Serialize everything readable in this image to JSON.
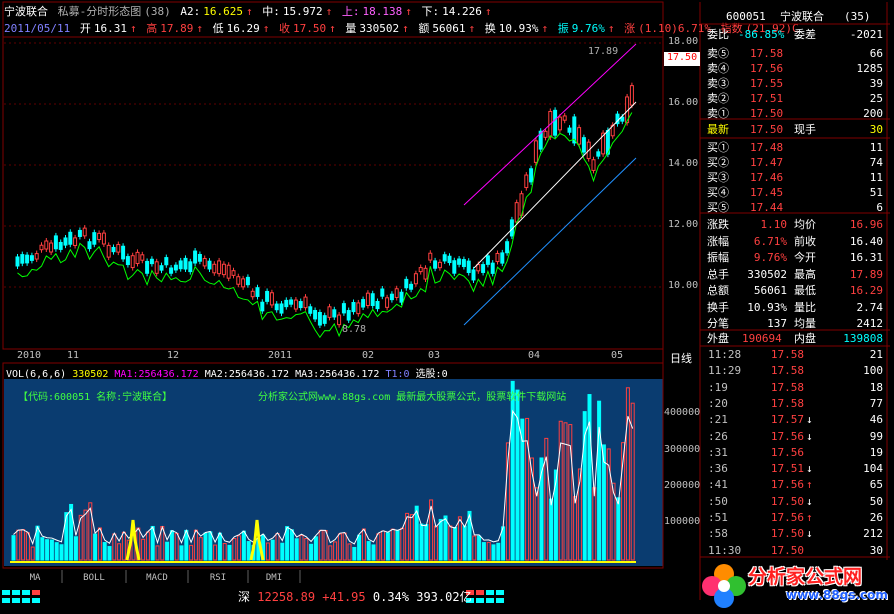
{
  "header": {
    "stock_name": "宁波联合",
    "formula": "私募-分时形态图",
    "params": "(38)",
    "a2_label": "A2:",
    "a2_value": "16.625",
    "mid_label": "中:",
    "mid_value": "15.972",
    "up_label": "上:",
    "up_value": "18.138",
    "down_label": "下:",
    "down_value": "14.226",
    "date": "2011/05/11",
    "open_label": "开",
    "open_value": "16.31",
    "high_label": "高",
    "high_value": "17.89",
    "low_label": "低",
    "low_value": "16.29",
    "close_label": "收",
    "close_value": "17.50",
    "vol_label": "量",
    "vol_value": "330502",
    "amt_label": "额",
    "amt_value": "56061",
    "turn_label": "换",
    "turn_value": "10.93%",
    "amp_label": "振",
    "amp_value": "9.76%",
    "chg_label": "涨",
    "chg_value": "(1.10)6.71%",
    "index_label": "指数",
    "index_value": "(21.92)C"
  },
  "price_axis": [
    "18.00",
    "16.00",
    "14.00",
    "12.00",
    "10.00"
  ],
  "price_tag": "17.50",
  "high_mark": "17.89",
  "low_mark": "8.78",
  "x_axis": [
    "2010",
    "11",
    "12",
    "2011",
    "02",
    "03",
    "04",
    "05"
  ],
  "day_line_label": "日线",
  "volume_header": {
    "vol_label": "VOL(6,6,6)",
    "vol_value": "330502",
    "ma1_label": "MA1:",
    "ma1_value": "256436.172",
    "ma2_label": "MA2:",
    "ma2_value": "256436.172",
    "ma3_label": "MA3:",
    "ma3_value": "256436.172",
    "t1_label": "T1:",
    "t1_value": "0",
    "pick_label": "选股:",
    "pick_value": "0"
  },
  "volume_overlay": {
    "code_text": "【代码:600051 名称:宁波联合】",
    "ad_text": "分析家公式网www.88gs.com 最新最大股票公式，股票软件下载网站"
  },
  "volume_axis": [
    "400000",
    "300000",
    "200000",
    "100000"
  ],
  "tabs": [
    "MA",
    "BOLL",
    "MACD",
    "RSI",
    "DMI"
  ],
  "quote": {
    "code": "600051",
    "name": "宁波联合",
    "badge": "(35)",
    "ratio_label": "委比",
    "ratio_value": "-86.85%",
    "diff_label": "委差",
    "diff_value": "-2021",
    "asks": [
      {
        "label": "卖⑤",
        "price": "17.58",
        "vol": "66"
      },
      {
        "label": "卖④",
        "price": "17.56",
        "vol": "1285"
      },
      {
        "label": "卖③",
        "price": "17.55",
        "vol": "39"
      },
      {
        "label": "卖②",
        "price": "17.51",
        "vol": "25"
      },
      {
        "label": "卖①",
        "price": "17.50",
        "vol": "200"
      }
    ],
    "last_label": "最新",
    "last_value": "17.50",
    "hand_label": "现手",
    "hand_value": "30",
    "bids": [
      {
        "label": "买①",
        "price": "17.48",
        "vol": "11"
      },
      {
        "label": "买②",
        "price": "17.47",
        "vol": "74"
      },
      {
        "label": "买③",
        "price": "17.46",
        "vol": "11"
      },
      {
        "label": "买④",
        "price": "17.45",
        "vol": "51"
      },
      {
        "label": "买⑤",
        "price": "17.44",
        "vol": "6"
      }
    ],
    "stats": [
      {
        "l1": "涨跌",
        "v1": "1.10",
        "l2": "均价",
        "v2": "16.96"
      },
      {
        "l1": "涨幅",
        "v1": "6.71%",
        "l2": "前收",
        "v2": "16.40"
      },
      {
        "l1": "振幅",
        "v1": "9.76%",
        "l2": "今开",
        "v2": "16.31"
      },
      {
        "l1": "总手",
        "v1": "330502",
        "l2": "最高",
        "v2": "17.89"
      },
      {
        "l1": "总额",
        "v1": "56061",
        "l2": "最低",
        "v2": "16.29"
      },
      {
        "l1": "换手",
        "v1": "10.93%",
        "l2": "量比",
        "v2": "2.74"
      },
      {
        "l1": "分笔",
        "v1": "137",
        "l2": "均量",
        "v2": "2412"
      }
    ],
    "outer_label": "外盘",
    "outer_value": "190694",
    "inner_label": "内盘",
    "inner_value": "139808"
  },
  "ticks": [
    {
      "time": "11:28",
      "price": "17.58",
      "arrow": "",
      "vol": "21"
    },
    {
      "time": "11:29",
      "price": "17.58",
      "arrow": "",
      "vol": "100"
    },
    {
      "time": ":19",
      "price": "17.58",
      "arrow": "",
      "vol": "18"
    },
    {
      "time": ":20",
      "price": "17.58",
      "arrow": "",
      "vol": "77"
    },
    {
      "time": ":21",
      "price": "17.57",
      "arrow": "↓",
      "vol": "46"
    },
    {
      "time": ":26",
      "price": "17.56",
      "arrow": "↓",
      "vol": "99"
    },
    {
      "time": ":31",
      "price": "17.56",
      "arrow": "",
      "vol": "19"
    },
    {
      "time": ":36",
      "price": "17.51",
      "arrow": "↓",
      "vol": "104"
    },
    {
      "time": ":41",
      "price": "17.56",
      "arrow": "↑",
      "vol": "65"
    },
    {
      "time": ":50",
      "price": "17.50",
      "arrow": "↓",
      "vol": "50"
    },
    {
      "time": ":51",
      "price": "17.56",
      "arrow": "↑",
      "vol": "26"
    },
    {
      "time": ":58",
      "price": "17.50",
      "arrow": "↓",
      "vol": "212"
    },
    {
      "time": "11:30",
      "price": "17.50",
      "arrow": "",
      "vol": "30"
    }
  ],
  "bottom": {
    "market": "深",
    "index_value": "12258.89",
    "index_change": "+41.95",
    "index_pct": "0.34%",
    "index_amount": "393.02亿"
  },
  "watermark": {
    "text": "分析家公式网",
    "url": "www.88gs.com"
  },
  "colors": {
    "up": "#ff4040",
    "down": "#00ffff",
    "ma_green": "#00ff00",
    "channel_upper": "#ff00ff",
    "channel_lower": "#2090ff",
    "mid_line": "#ffffff",
    "volume_bg": "#0a3c70"
  }
}
